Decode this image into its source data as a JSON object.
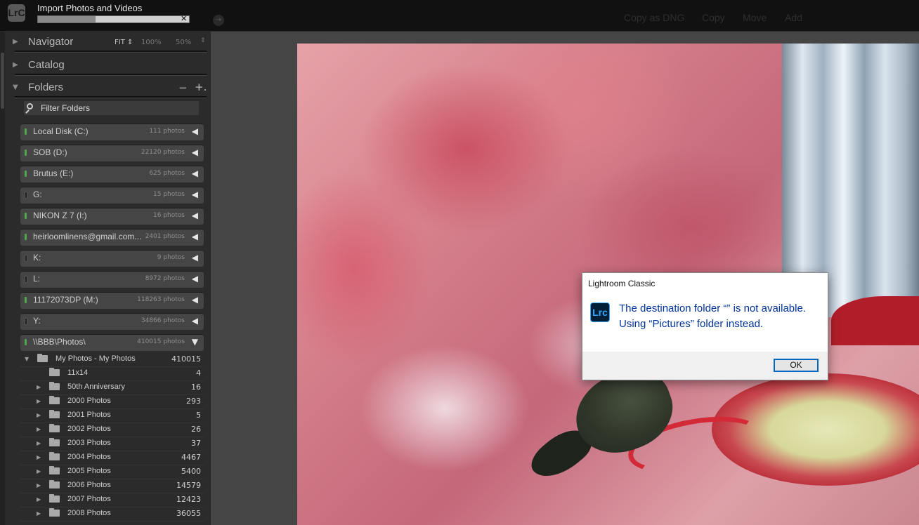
{
  "import": {
    "logo": "LrC",
    "title": "Import Photos and Videos",
    "progress_fraction": 0.38,
    "cancel_glyph": "✕"
  },
  "module_picker": [
    "Copy as DNG",
    "Copy",
    "Move",
    "Add"
  ],
  "navigator": {
    "title": "Navigator",
    "fit": "FIT ⇕",
    "zoom_100": "100%",
    "zoom_50": "50%",
    "arrows": "⇕"
  },
  "catalog": {
    "title": "Catalog"
  },
  "folders": {
    "title": "Folders",
    "minus": "−",
    "plus": "+.",
    "filter_placeholder": "Filter Folders",
    "volumes": [
      {
        "name": "Local Disk (C:)",
        "count": "111 photos",
        "online": true,
        "arrow": "◀"
      },
      {
        "name": "SOB (D:)",
        "count": "22120 photos",
        "online": true,
        "arrow": "◀"
      },
      {
        "name": "Brutus (E:)",
        "count": "625 photos",
        "online": true,
        "arrow": "◀"
      },
      {
        "name": "G:",
        "count": "15 photos",
        "online": false,
        "arrow": "◀"
      },
      {
        "name": "NIKON Z 7   (I:)",
        "count": "16 photos",
        "online": true,
        "arrow": "◀"
      },
      {
        "name": "heirloomlinens@gmail.com...",
        "count": "2401 photos",
        "online": true,
        "arrow": "◀"
      },
      {
        "name": "K:",
        "count": "9 photos",
        "online": false,
        "arrow": "◀"
      },
      {
        "name": "L:",
        "count": "8972 photos",
        "online": false,
        "arrow": "◀"
      },
      {
        "name": "11172073DP (M:)",
        "count": "118263 photos",
        "online": true,
        "arrow": "◀"
      },
      {
        "name": "Y:",
        "count": "34866 photos",
        "online": false,
        "arrow": "◀"
      },
      {
        "name": "\\\\BBB\\Photos\\",
        "count": "410015 photos",
        "online": true,
        "arrow": "▼"
      }
    ],
    "tree": [
      {
        "name": "My Photos - My Photos",
        "count": "410015",
        "level": 0,
        "expanded": true
      },
      {
        "name": "11x14",
        "count": "4",
        "level": 1,
        "has_children": false
      },
      {
        "name": "50th Anniversary",
        "count": "16",
        "level": 1,
        "has_children": true
      },
      {
        "name": "2000 Photos",
        "count": "293",
        "level": 1,
        "has_children": true
      },
      {
        "name": "2001 Photos",
        "count": "5",
        "level": 1,
        "has_children": true
      },
      {
        "name": "2002 Photos",
        "count": "26",
        "level": 1,
        "has_children": true
      },
      {
        "name": "2003 Photos",
        "count": "37",
        "level": 1,
        "has_children": true
      },
      {
        "name": "2004 Photos",
        "count": "4467",
        "level": 1,
        "has_children": true
      },
      {
        "name": "2005 Photos",
        "count": "5400",
        "level": 1,
        "has_children": true
      },
      {
        "name": "2006 Photos",
        "count": "14579",
        "level": 1,
        "has_children": true
      },
      {
        "name": "2007 Photos",
        "count": "12423",
        "level": 1,
        "has_children": true
      },
      {
        "name": "2008 Photos",
        "count": "36055",
        "level": 1,
        "has_children": true
      }
    ]
  },
  "dialog": {
    "title": "Lightroom Classic",
    "icon_text": "Lrc",
    "message_line1": "The destination folder “” is not available.",
    "message_line2": "Using “Pictures” folder instead.",
    "ok_label": "OK"
  },
  "colors": {
    "accent_blue": "#003399",
    "lrc_icon_bg": "#001e36",
    "lrc_icon_fg": "#31a8ff",
    "online_led": "#4fa84f"
  }
}
